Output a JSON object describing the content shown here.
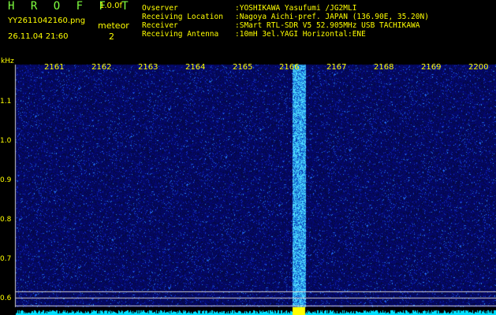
{
  "header": {
    "app_title": "H R O F F T",
    "version": "1.0.0f",
    "filename": "YY2611042160.png",
    "datetime": "26.11.04 21:60",
    "meteor_label": "meteor",
    "meteor_count": "2"
  },
  "station": [
    {
      "label": "Ovserver",
      "value": ":YOSHIKAWA Yasufumi /JG2MLI"
    },
    {
      "label": "Receiving Location",
      "value": ":Nagoya Aichi-pref. JAPAN (136.90E, 35.20N)"
    },
    {
      "label": "Receiver",
      "value": ":SMart RTL-SDR V5 52.905MHz USB TACHIKAWA"
    },
    {
      "label": "Receiving Antenna",
      "value": ":10mH 3el.YAGI Horizontal:ENE"
    }
  ],
  "axis": {
    "y_unit": "kHz",
    "y_ticks": [
      "1.1",
      "1.0",
      "0.9",
      "0.8",
      "0.7",
      "0.6"
    ],
    "x_ticks": [
      "2161",
      "2162",
      "2163",
      "2164",
      "2165",
      "2166",
      "2167",
      "2168",
      "2169",
      "2200"
    ]
  },
  "colors": {
    "background": "#000000",
    "noise_base": "#0a0a6a",
    "noise_bright": "#2244ff",
    "trace": "#00e0ff",
    "meteor": "#60d0ff",
    "marker": "#ffff00",
    "label": "#ffff00",
    "title": "#7fff3f"
  }
}
